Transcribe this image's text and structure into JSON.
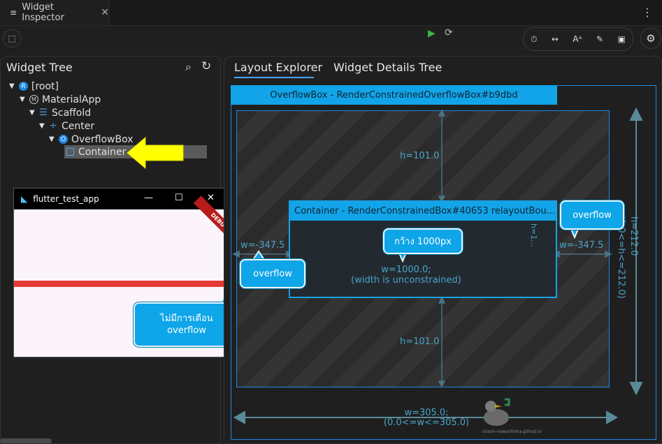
{
  "tab": {
    "icon": "list-icon",
    "title": "Widget Inspector",
    "close": "✕"
  },
  "header": {
    "more": "⋮"
  },
  "toolbar": {
    "tool_icons": [
      "⏱",
      "↔",
      "Aᴬ",
      "✎",
      "▣"
    ],
    "gear": "⚙"
  },
  "left_panel": {
    "title": "Widget Tree",
    "tree": [
      {
        "label": "[root]",
        "badge": "R"
      },
      {
        "label": "MaterialApp",
        "badge": "Ⓜ"
      },
      {
        "label": "Scaffold",
        "badge": "☰"
      },
      {
        "label": "Center",
        "badge": "÷"
      },
      {
        "label": "OverflowBox",
        "badge": "O"
      },
      {
        "label": "Container",
        "badge": "□"
      }
    ]
  },
  "flutter_window": {
    "title": "flutter_test_app",
    "controls": [
      "—",
      "☐",
      "✕"
    ],
    "debug_banner": "DEBUG",
    "callout": "ไม่มีการเตือน overflow"
  },
  "right_panel": {
    "tabs": [
      "Layout Explorer",
      "Widget Details Tree"
    ],
    "overflow_box_header": "OverflowBox - RenderConstrainedOverflowBox#b9dbd",
    "container_header": "Container - RenderConstrainedBox#40653 relayoutBou...",
    "h_top": "h=101.0",
    "h_bottom": "h=101.0",
    "w_left": "w=-347.5",
    "w_right": "w=-347.5",
    "inner_h": "h=1...",
    "inner_w_line1": "w=1000.0;",
    "inner_w_line2": "(width is unconstrained)",
    "outer_h_line1": "h=212.0",
    "outer_h_line2": "(0.0<=h<=212.0)",
    "outer_w_line1": "w=305.0;",
    "outer_w_line2": "(0.0<=w<=305.0)",
    "callout_overflow_left": "overflow",
    "callout_overflow_right": "overflow",
    "callout_width": "กว้าง 1000px",
    "watermark": "charin-nawaritloha.github.io"
  },
  "colors": {
    "accent": "#12a4e8",
    "measure": "#4aa3c9",
    "play": "#3fb24a",
    "arrow": "#ffff00"
  }
}
